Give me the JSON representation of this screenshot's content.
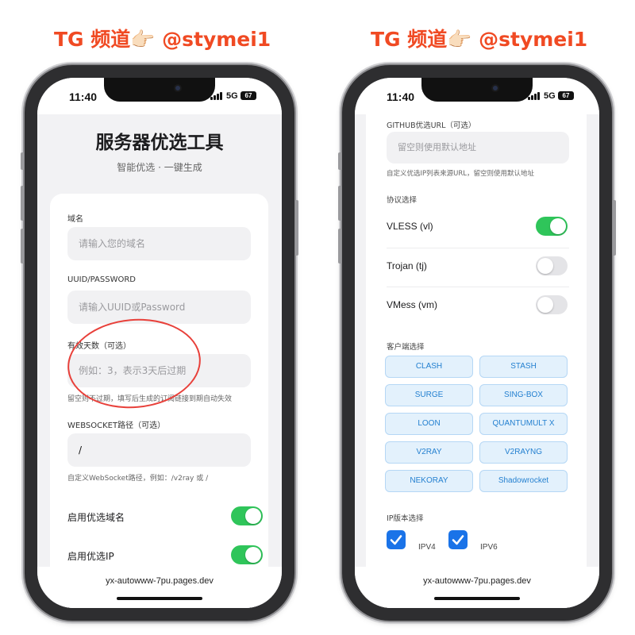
{
  "banner": {
    "left": "TG 频道👉🏻 @stymei1",
    "right": "TG 频道👉🏻 @stymei1"
  },
  "status": {
    "time": "11:40",
    "network": "5G",
    "battery": "67"
  },
  "url_bar": {
    "url": "yx-autowww-7pu.pages.dev"
  },
  "left_screen": {
    "title": "服务器优选工具",
    "subtitle": "智能优选 · 一键生成",
    "domain": {
      "label": "域名",
      "placeholder": "请输入您的域名"
    },
    "uuid": {
      "label": "UUID/PASSWORD",
      "placeholder": "请输入UUID或Password"
    },
    "expiry": {
      "label": "有效天数（可选）",
      "placeholder": "例如：3，表示3天后过期",
      "hint": "留空则不过期，填写后生成的订阅链接到期自动失效"
    },
    "websocket": {
      "label": "WEBSOCKET路径（可选）",
      "value": "/",
      "hint": "自定义WebSocket路径，例如：/v2ray 或 /"
    },
    "toggles": [
      {
        "label": "启用优选域名",
        "on": true
      },
      {
        "label": "启用优选IP",
        "on": true
      }
    ]
  },
  "right_screen": {
    "github": {
      "label": "GITHUB优选URL（可选）",
      "placeholder": "留空则使用默认地址",
      "hint": "自定义优选IP列表来源URL，留空则使用默认地址"
    },
    "protocol": {
      "label": "协议选择",
      "items": [
        {
          "label": "VLESS (vl)",
          "on": true
        },
        {
          "label": "Trojan (tj)",
          "on": false
        },
        {
          "label": "VMess (vm)",
          "on": false
        }
      ]
    },
    "client": {
      "label": "客户端选择",
      "items": [
        "CLASH",
        "STASH",
        "SURGE",
        "SING-BOX",
        "LOON",
        "QUANTUMULT X",
        "V2RAY",
        "V2RAYNG",
        "NEKORAY",
        "Shadowrocket"
      ]
    },
    "ip_version": {
      "label": "IP版本选择",
      "items": [
        {
          "label": "IPV4",
          "checked": true
        },
        {
          "label": "IPV6",
          "checked": true
        }
      ]
    }
  },
  "colors": {
    "banner": "#f04a23",
    "toggle_on": "#2fc55a",
    "chip_text": "#2480d0",
    "checkbox": "#1a73e8",
    "annotation": "#e8403a"
  }
}
